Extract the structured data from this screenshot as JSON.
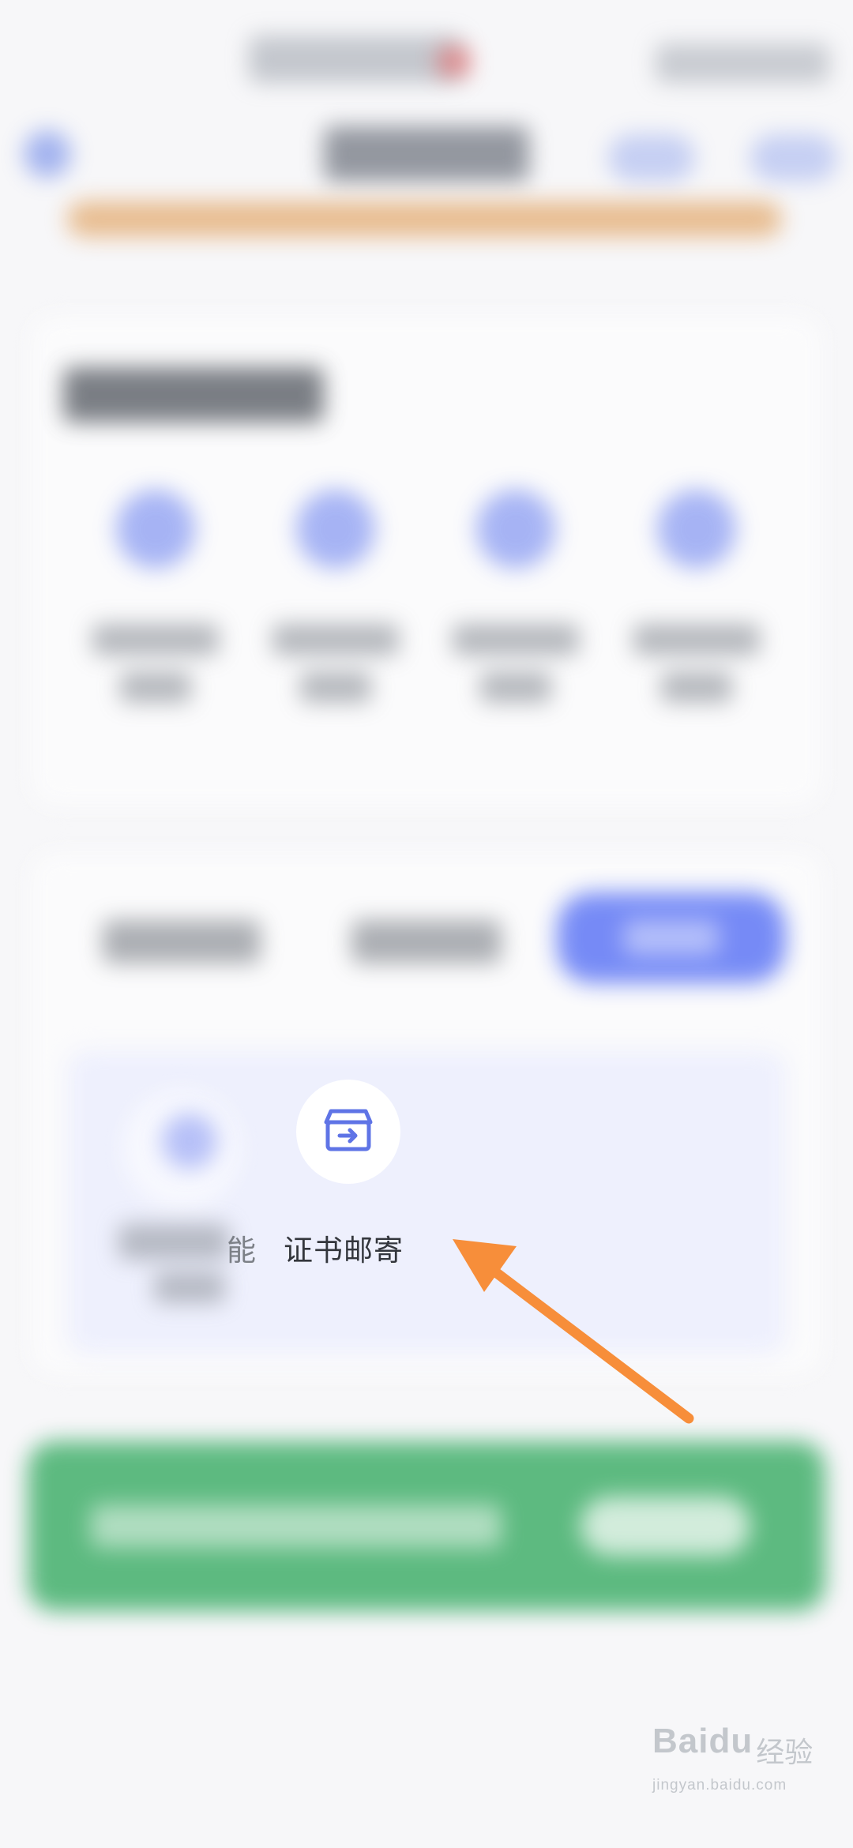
{
  "service_item": {
    "label": "证书邮寄",
    "icon": "archive-box-arrow-icon"
  },
  "neighbor_item": {
    "label_fragment": "能"
  },
  "annotation": {
    "arrow_color": "#f78e3a",
    "icon_color": "#5f74e6"
  },
  "watermark": {
    "brand": "Baidu",
    "brand_cn": "经验",
    "url": "jingyan.baidu.com"
  }
}
